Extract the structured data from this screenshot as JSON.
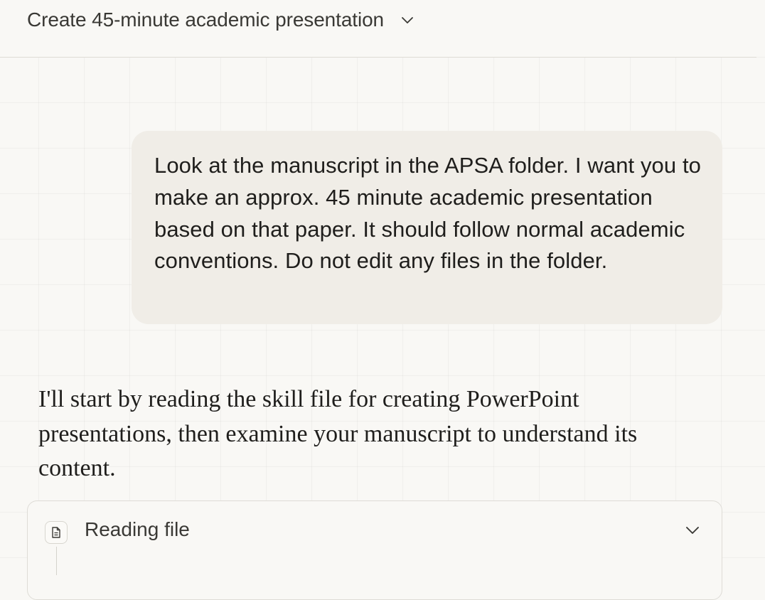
{
  "header": {
    "title": "Create 45-minute academic presentation",
    "dropdown_icon": "chevron-down-icon"
  },
  "conversation": {
    "user_message": "Look at the manuscript in the APSA folder. I want you to make an approx. 45 minute academic presentation based on that paper. It should follow normal academic conventions. Do not edit any files in the folder.",
    "assistant_message": "I'll start by reading the skill file for creating PowerPoint presentations, then examine your manuscript to understand its content.",
    "tool_call": {
      "label": "Reading file",
      "icon": "file-text-icon",
      "expand_icon": "chevron-down-icon"
    }
  },
  "colors": {
    "background": "#f9f8f5",
    "user_bubble": "#f0ede7",
    "text": "#1f1e1c",
    "border": "#dedcd6"
  }
}
